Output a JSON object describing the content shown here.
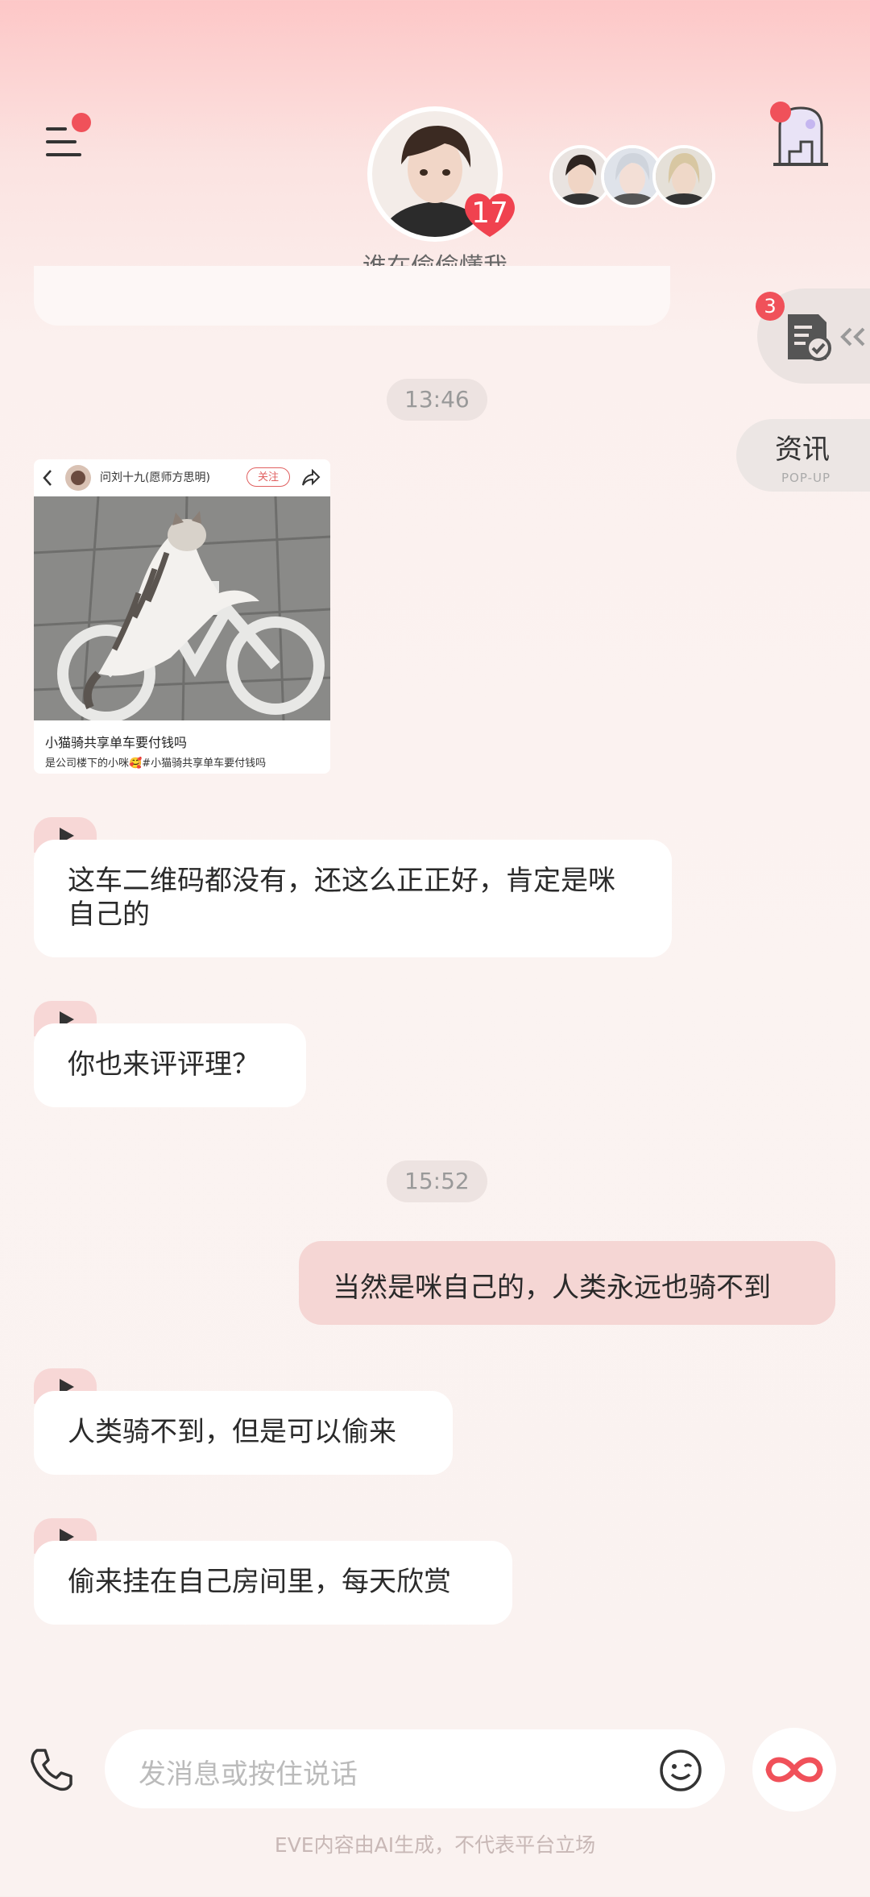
{
  "header": {
    "subtitle": "谁在偷偷懂我",
    "heart_count": "17"
  },
  "side": {
    "task_badge": "3",
    "info_label": "资讯",
    "info_sub": "POP-UP"
  },
  "shared_card": {
    "author": "问刘十九(愿师方思明)",
    "follow_label": "关注",
    "title": "小猫骑共享单车要付钱吗",
    "desc": "是公司楼下的小咪🥰#小猫骑共享单车要付钱吗"
  },
  "chat": {
    "time1": "13:46",
    "msg1": "这车二维码都没有，还这么正正好，肯定是咪自己的",
    "msg2": "你也来评评理？",
    "time2": "15:52",
    "msg_user": "当然是咪自己的，人类永远也骑不到",
    "msg3": "人类骑不到，但是可以偷来",
    "msg4": "偷来挂在自己房间里，每天欣赏"
  },
  "input": {
    "placeholder": "发消息或按住说话"
  },
  "footer": {
    "disclaimer": "EVE内容由AI生成，不代表平台立场"
  },
  "icons": [
    "menu-icon",
    "gate-icon",
    "task-doc-icon",
    "play-icon",
    "phone-icon",
    "emoji-icon",
    "infinity-icon"
  ],
  "colors": {
    "accent": "#f0515a",
    "user_bubble": "#f5d6d4"
  }
}
